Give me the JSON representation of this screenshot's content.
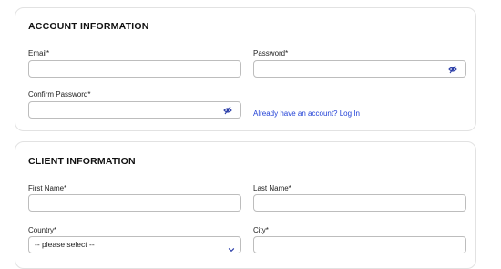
{
  "account_section": {
    "title": "ACCOUNT INFORMATION",
    "email_label": "Email*",
    "email_value": "",
    "password_label": "Password*",
    "password_value": "",
    "confirm_password_label": "Confirm Password*",
    "confirm_password_value": "",
    "login_link_text": "Already have an account? Log In",
    "toggle_icon": "eye-slash-icon"
  },
  "client_section": {
    "title": "CLIENT INFORMATION",
    "first_name_label": "First Name*",
    "first_name_value": "",
    "last_name_label": "Last Name*",
    "last_name_value": "",
    "country_label": "Country*",
    "country_selected": "-- please select --",
    "city_label": "City*",
    "city_value": ""
  },
  "colors": {
    "link": "#1f3fd6",
    "icon": "#2b3ea8",
    "border": "#bdbdbd",
    "card_border": "#e2e2e2"
  }
}
